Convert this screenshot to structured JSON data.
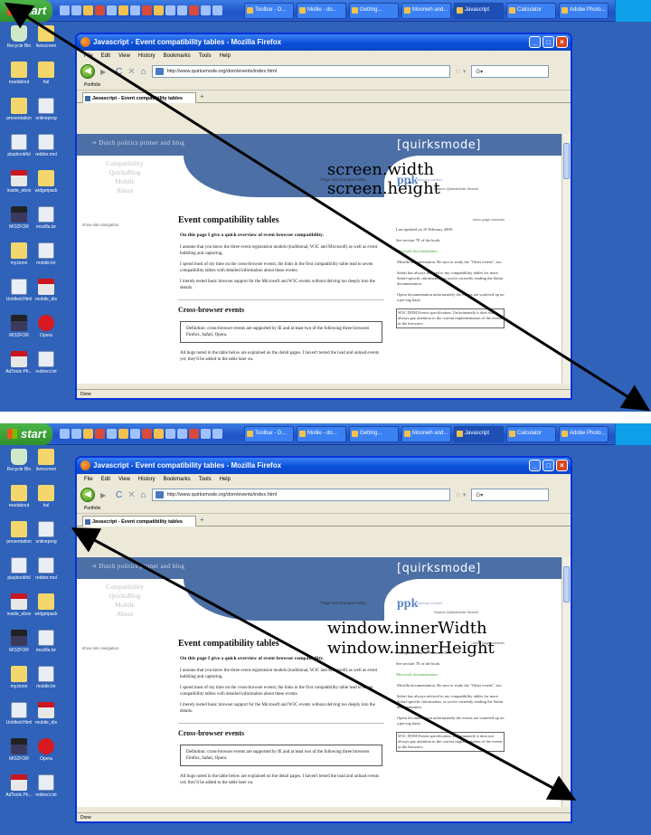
{
  "taskbar": {
    "start_label": "start",
    "tasks": [
      "Toolbar - D...",
      "Mollie - do...",
      "Getting...",
      "Moonwh and...",
      "Javascript",
      "Calculator",
      "Adobe Photo..."
    ],
    "active_task_index": 4
  },
  "desktop_icons": [
    "Recycle Bin",
    "livescreen",
    "readabout",
    "hal",
    "presentation",
    "onlineprog",
    "playbookfol",
    "redder.mol",
    "inside_ebox",
    "widgetpack",
    "MOZFOR",
    "mozilla.lsr",
    "my.boon",
    "mobile.lnr",
    "Untitled.Html",
    "mobile_dis",
    "MOZFOR",
    "Opera",
    "AdTools Ph...",
    "redirect.txt"
  ],
  "browser": {
    "window_title": "Javascript - Event compatibility tables - Mozilla Firefox",
    "menu": [
      "File",
      "Edit",
      "View",
      "History",
      "Bookmarks",
      "Tools",
      "Help"
    ],
    "url": "http://www.quirksmode.org/dom/events/index.html",
    "search_placeholder": "",
    "bookmark_item": "Portfolio",
    "tab_title": "Javascript - Event compatibility tables",
    "status": "Done"
  },
  "page": {
    "blog_link": "Dutch politics primer and blog",
    "logo": "[quirksmode]",
    "nav": [
      "Compatibility",
      "QuirksBlog",
      "Mobile",
      "About"
    ],
    "show_nav": "show site navigation",
    "last_changed": "Page last changed today",
    "ppk": "ppk",
    "ppk_links": "sitemap  contact",
    "ppk_links2": "Search QuirksMode  Search",
    "title": "Event compatibility tables",
    "lead": "On this page I give a quick overview of event browser compatibility.",
    "p1": "I assume that you know the three event registration models (traditional, W3C and Microsoft) as well as event bubbling and capturing.",
    "p2": "I spend most of my time on the cross-browser events; the links in the first compatibility table lead to seven compatibility tables with detailed information about these events.",
    "p3": "I merely tested basic browser support for the Microsoft and W3C events without delving too deeply into the details.",
    "h2": "Cross-browser events",
    "definition": "Definition: cross-browser events are supported by IE and at least two of the following three browsers Firefox, Safari, Opera.",
    "p4": "All bugs noted in the table below are explained on the detail pages. I haven't tested the load and unload events yet; they'll be added to the table later on.",
    "sidebar_tools": "show page contents",
    "sidebar_updated": "Last updated on 10 February 2009.",
    "sidebar_seesection": "See section 7E of the book.",
    "sidebar_msdoc": "Microsoft documentation.",
    "sidebar_mozdoc": "Mozilla documentation. Be sure to study the \"Other events\", too.",
    "sidebar_safari": "Safari has always referred to my compatibility tables for more Safari-specific information, so you're currently reading the Safari documentation.",
    "sidebar_opera": "Opera documentation unfortunately the events are scattered up on a per-tag basis.",
    "sidebar_w3c": "W3C DOM Events specification. Unfortunately it does not always pay attention to the current implementation of the events in the browsers."
  },
  "annotations": {
    "top": [
      "screen.width",
      "screen.height"
    ],
    "bottom": [
      "window.innerWidth",
      "window.innerHeight"
    ]
  }
}
